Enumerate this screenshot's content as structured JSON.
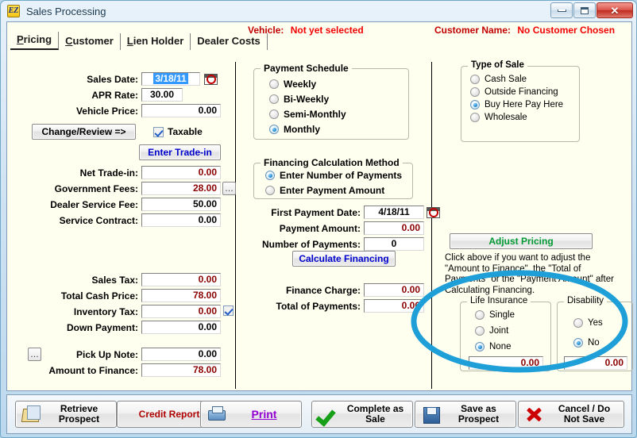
{
  "window": {
    "title": "Sales Processing",
    "icon": "ez-app-icon",
    "controls": {
      "minimize": "Minimize",
      "maximize": "Maximize",
      "close": "Close"
    }
  },
  "header": {
    "vehicle_label": "Vehicle:",
    "vehicle_value": "Not yet selected",
    "customer_label": "Customer Name:",
    "customer_value": "No Customer Chosen",
    "alert_color": "#ee0000"
  },
  "tabs": [
    {
      "label": "Pricing",
      "accel": "P",
      "active": true
    },
    {
      "label": "Customer",
      "accel": "C",
      "active": false
    },
    {
      "label": "Lien Holder",
      "accel": "L",
      "active": false
    },
    {
      "label": "Dealer Costs",
      "accel": "D",
      "active": false
    }
  ],
  "pricing": {
    "sales_date": {
      "label": "Sales Date:",
      "value": "3/18/11",
      "selected": true
    },
    "apr_rate": {
      "label": "APR Rate:",
      "value": "30.00"
    },
    "vehicle_price": {
      "label": "Vehicle Price:",
      "value": "0.00"
    },
    "change_review_button": "Change/Review =>",
    "taxable": {
      "label": "Taxable",
      "checked": true
    },
    "enter_trade_in_button": "Enter Trade-in",
    "net_trade_in": {
      "label": "Net Trade-in:",
      "value": "0.00"
    },
    "government_fees": {
      "label": "Government Fees:",
      "value": "28.00"
    },
    "dealer_service_fee": {
      "label": "Dealer Service Fee:",
      "value": "50.00"
    },
    "service_contract": {
      "label": "Service Contract:",
      "value": "0.00"
    },
    "sales_tax": {
      "label": "Sales Tax:",
      "value": "0.00"
    },
    "total_cash_price": {
      "label": "Total Cash Price:",
      "value": "78.00"
    },
    "inventory_tax": {
      "label": "Inventory Tax:",
      "value": "0.00",
      "checked": true
    },
    "down_payment": {
      "label": "Down Payment:",
      "value": "0.00"
    },
    "pick_up_note": {
      "label": "Pick Up Note:",
      "value": "0.00"
    },
    "amount_to_finance": {
      "label": "Amount to Finance:",
      "value": "78.00"
    }
  },
  "payment_schedule": {
    "title": "Payment Schedule",
    "options": [
      {
        "label": "Weekly",
        "selected": false
      },
      {
        "label": "Bi-Weekly",
        "selected": false
      },
      {
        "label": "Semi-Monthly",
        "selected": false
      },
      {
        "label": "Monthly",
        "selected": true
      }
    ]
  },
  "financing_method": {
    "title": "Financing Calculation Method",
    "options": [
      {
        "label": "Enter Number of Payments",
        "selected": true
      },
      {
        "label": "Enter Payment Amount",
        "selected": false
      }
    ],
    "first_payment_date": {
      "label": "First Payment Date:",
      "value": "4/18/11"
    },
    "payment_amount": {
      "label": "Payment Amount:",
      "value": "0.00"
    },
    "number_of_payments": {
      "label": "Number of Payments:",
      "value": "0"
    },
    "calculate_button": "Calculate Financing",
    "finance_charge": {
      "label": "Finance Charge:",
      "value": "0.00"
    },
    "total_of_payments": {
      "label": "Total of Payments:",
      "value": "0.00"
    }
  },
  "type_of_sale": {
    "title": "Type of Sale",
    "options": [
      {
        "label": "Cash Sale",
        "selected": false
      },
      {
        "label": "Outside Financing",
        "selected": false
      },
      {
        "label": "Buy Here Pay Here",
        "selected": true
      },
      {
        "label": "Wholesale",
        "selected": false
      }
    ]
  },
  "adjust_pricing": {
    "button": "Adjust Pricing",
    "button_color": "#009933",
    "help_text": "Click above if you want to adjust the \"Amount to Finance\", the \"Total of Payments\" or the \"Payment Amount\" after Calculating Financing."
  },
  "life_insurance": {
    "title": "Life Insurance",
    "options": [
      {
        "label": "Single",
        "selected": false
      },
      {
        "label": "Joint",
        "selected": false
      },
      {
        "label": "None",
        "selected": true
      }
    ],
    "amount": "0.00"
  },
  "disability": {
    "title": "Disability",
    "options": [
      {
        "label": "Yes",
        "selected": false
      },
      {
        "label": "No",
        "selected": true
      }
    ],
    "amount": "0.00"
  },
  "annotation": {
    "shape": "ellipse-highlight",
    "color": "#1e9fd8"
  },
  "bottom_bar": {
    "retrieve_prospect": "Retrieve\nProspect",
    "credit_report": "Credit Report",
    "print": "Print",
    "complete_as_sale": "Complete as\nSale",
    "save_as_prospect": "Save as\nProspect",
    "cancel_do_not_save": "Cancel / Do\nNot Save"
  }
}
